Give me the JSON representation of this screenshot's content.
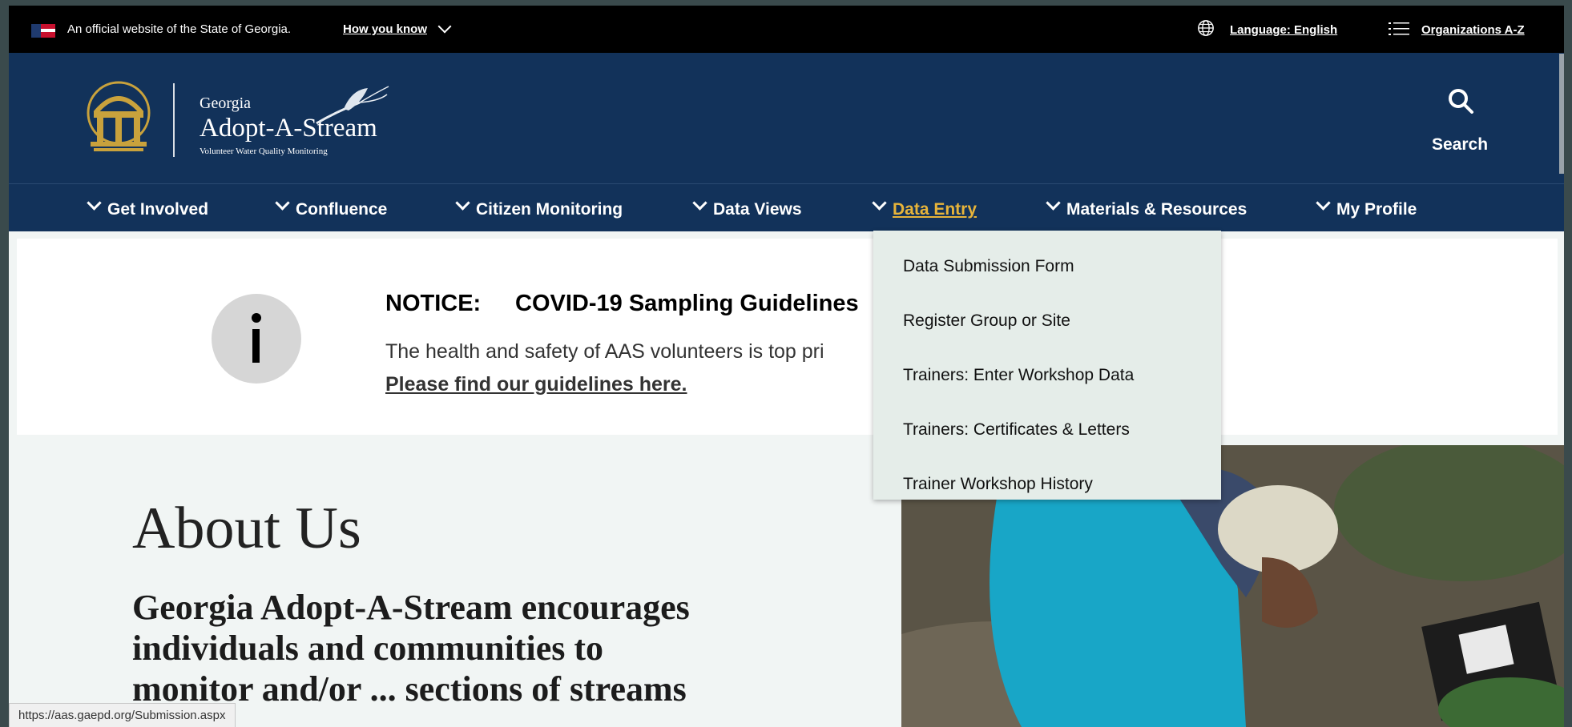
{
  "topbar": {
    "official_text": "An official website of the State of Georgia.",
    "how_you_know": "How you know",
    "language": "Language: English",
    "organizations": "Organizations A-Z"
  },
  "header": {
    "brand_georgia": "Georgia",
    "brand_name": "Adopt-A-Stream",
    "brand_tagline": "Volunteer Water Quality Monitoring",
    "search_label": "Search"
  },
  "nav": {
    "items": [
      {
        "label": "Get Involved"
      },
      {
        "label": "Confluence"
      },
      {
        "label": "Citizen Monitoring"
      },
      {
        "label": "Data Views"
      },
      {
        "label": "Data Entry"
      },
      {
        "label": "Materials & Resources"
      },
      {
        "label": "My Profile"
      }
    ],
    "active": "Data Entry"
  },
  "dropdown": {
    "items": [
      {
        "label": "Data Submission Form"
      },
      {
        "label": "Register Group or Site"
      },
      {
        "label": "Trainers: Enter Workshop Data"
      },
      {
        "label": "Trainers: Certificates & Letters"
      },
      {
        "label": "Trainer Workshop History"
      }
    ]
  },
  "notice": {
    "label": "NOTICE:",
    "title": "COVID-19 Sampling Guidelines",
    "text": "The health and safety of AAS volunteers is top pri",
    "link": "Please find our guidelines here."
  },
  "about": {
    "title": "About Us",
    "body": "Georgia Adopt-A-Stream encourages individuals and communities to monitor and/or ... sections of streams"
  },
  "status_url": "https://aas.gaepd.org/Submission.aspx",
  "colors": {
    "navy": "#12325a",
    "gold": "#e7b43a",
    "dropdown_bg": "#e5ede9"
  }
}
